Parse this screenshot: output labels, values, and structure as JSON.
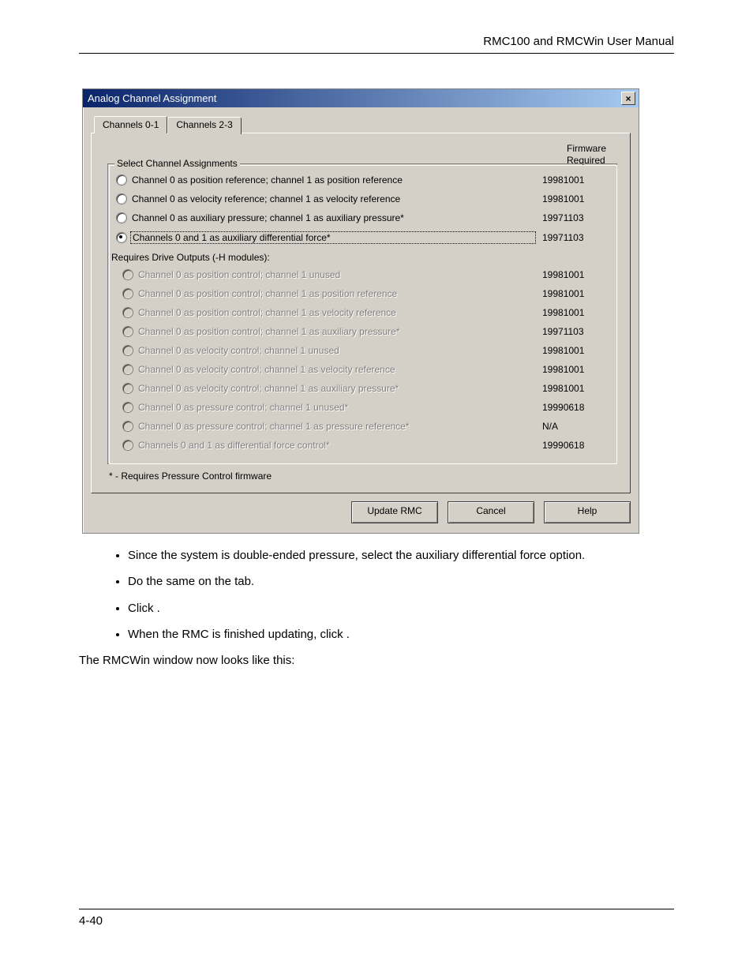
{
  "doc_header": "RMC100 and RMCWin User Manual",
  "page_number": "4-40",
  "dialog": {
    "title": "Analog Channel Assignment",
    "close_glyph": "×",
    "tabs": [
      "Channels 0-1",
      "Channels 2-3"
    ],
    "firmware_header_line1": "Firmware",
    "firmware_header_line2": "Required",
    "group_title": "Select Channel Assignments",
    "options_top": [
      {
        "label": "Channel 0 as position reference; channel 1 as position reference",
        "fw": "19981001",
        "checked": false
      },
      {
        "label": "Channel 0 as velocity reference; channel 1 as velocity reference",
        "fw": "19981001",
        "checked": false
      },
      {
        "label": "Channel 0 as auxiliary pressure; channel 1 as auxiliary pressure*",
        "fw": "19971103",
        "checked": false
      },
      {
        "label": "Channels 0 and 1 as auxiliary differential force*",
        "fw": "19971103",
        "checked": true
      }
    ],
    "sub_header": "Requires Drive Outputs (-H modules):",
    "options_bottom": [
      {
        "label": "Channel 0 as position control; channel 1 unused",
        "fw": "19981001"
      },
      {
        "label": "Channel 0 as position control; channel 1 as position reference",
        "fw": "19981001"
      },
      {
        "label": "Channel 0 as position control; channel 1 as velocity reference",
        "fw": "19981001"
      },
      {
        "label": "Channel 0 as position control; channel 1 as auxiliary pressure*",
        "fw": "19971103"
      },
      {
        "label": "Channel 0 as velocity control; channel 1 unused",
        "fw": "19981001"
      },
      {
        "label": "Channel 0 as velocity control; channel 1 as velocity reference",
        "fw": "19981001"
      },
      {
        "label": "Channel 0 as velocity control; channel 1 as auxiliary pressure*",
        "fw": "19981001"
      },
      {
        "label": "Channel 0 as pressure control; channel 1 unused*",
        "fw": "19990618"
      },
      {
        "label": "Channel 0 as pressure control; channel 1 as pressure reference*",
        "fw": "N/A"
      },
      {
        "label": "Channels 0 and 1 as differential force control*",
        "fw": "19990618"
      }
    ],
    "footnote": "* - Requires Pressure Control firmware",
    "buttons": {
      "update": "Update RMC",
      "cancel": "Cancel",
      "help": "Help"
    }
  },
  "body_text": {
    "bullets": [
      "Since the system is double-ended pressure, select the auxiliary differential force option.",
      "Do the same on the                              tab.",
      "Click                       .",
      "When the RMC is finished updating, click          ."
    ],
    "footer_para": "The RMCWin window now looks like this:"
  }
}
